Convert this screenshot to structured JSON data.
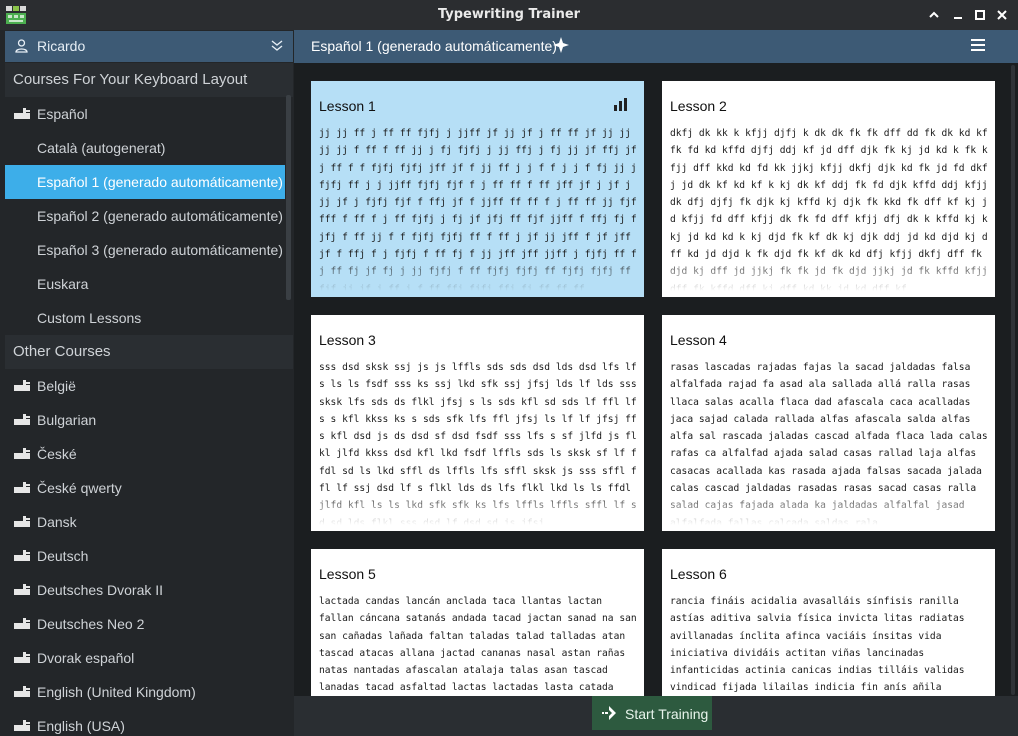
{
  "window": {
    "title": "Typewriting Trainer"
  },
  "sidebar": {
    "profile": "Ricardo",
    "section_courses": "Courses For Your Keyboard Layout",
    "courses": [
      {
        "label": "Español",
        "icon": "keyboard-icon"
      },
      {
        "label": "Català (autogenerat)"
      },
      {
        "label": "Español 1 (generado automáticamente)",
        "selected": true
      },
      {
        "label": "Español 2 (generado automáticamente)"
      },
      {
        "label": "Español 3 (generado automáticamente)"
      },
      {
        "label": "Euskara"
      },
      {
        "label": "Custom Lessons"
      }
    ],
    "section_other": "Other Courses",
    "other": [
      {
        "label": "België"
      },
      {
        "label": "Bulgarian"
      },
      {
        "label": "České"
      },
      {
        "label": "České qwerty"
      },
      {
        "label": "Dansk"
      },
      {
        "label": "Deutsch"
      },
      {
        "label": "Deutsches Dvorak II"
      },
      {
        "label": "Deutsches Neo 2"
      },
      {
        "label": "Dvorak español"
      },
      {
        "label": "English (United Kingdom)"
      },
      {
        "label": "English (USA)"
      }
    ]
  },
  "header": {
    "course_title": "Español 1 (generado automáticamente)"
  },
  "lessons": [
    {
      "title": "Lesson 1",
      "text": "jj jj ff j ff ff fjfj j jjff jf jj jf j ff ff jf jj jj jj jj f ff f ff jj j fj fjfj j jj ffj j fj jj jf ffj jf j ff f f fjfj fjfj jff jf f jj ff j j f f j j f fj jj j fjfj ff j j jjff fjfj fjf f j ff ff f ff jff jf j jf j jj jf j fjfj fjf f ffj jf f jjff ff ff f j ff ff jj fjf fff f ff f j ff fjfj j fj jf jfj ff fjf jjff f ffj fj fjfj f ff jj f f fjfj fjfj ff f ff j jf jj jff f jf jff jf f ffj f j fjfj f ff fj f jj jff jff jjff j fjfj ff fj ff fj jf fj j jj fjfj f ff fjfj fjfj ff fjfj fjfj ff fjf jj jf j ff j f ff ffj fjfj ffj fj ff ff ff"
    },
    {
      "title": "Lesson 2",
      "text": "dkfj dk kk k kfjj djfj k dk dk fk fk dff dd fk dk kd kf fk fd kd kffd djfj ddj kf jd dff djk fk kj jd kd k fk kfjj dff kkd kd fd kk jjkj kfjj dkfj djk kd fk jd fd dkfj jd dk kf kd kf k kj dk kf ddj fk fd djk kffd ddj kfjj dk dfj djfj fk djk kj kffd kj djk fk kkd fk dff kf kj jd kfjj fd dff kfjj dk fk fd dff kfjj dfj dk k kffd kj k kj jd kd kd k kj djd fk kf dk kj djk ddj jd kd djd kj dff kd jd djd k fk djd fk kf dk kd dfj kfjj dkfj dff fk djd kj dff jd jjkj fk fk jd fk djd jjkj jd fk kffd kfjj dff fk kffd dff kj dff kd kk jd kd dff kf"
    },
    {
      "title": "Lesson 3",
      "text": "sss dsd sksk ssj js js lffls sds sds dsd lds dsd lfs lfs ls ls fsdf sss ks ssj lkd sfk ssj jfsj lds lf lds sss sksk lfs sds ds flkl jfsj s ls sds kfl sd sds lf ffl lfs s kfl kkss ks s sds sfk lfs ffl jfsj ls lf lf jfsj ffs kfl dsd js ds dsd sf dsd fsdf sss lfs s sf jlfd js flkl jlfd kkss dsd kfl lkd fsdf lffls sds ls sksk sf lf ffdl sd ls lkd sffl ds lffls lfs sffl sksk js sss sffl ffl lf ssj dsd lf s flkl lds ds lfs flkl lkd ls ls ffdl jlfd kfl ls ls lkd sfk sfk ks lfs lffls lffls sffl lf sd sd lds flkl sss dsd lf dsd sd js jfsj"
    },
    {
      "title": "Lesson 4",
      "text": "rasas lascadas rajadas fajas la sacad jaldadas falsa alfalfada rajad fa asad ala sallada allá ralla rasas llaca salas acalla flaca dad afascala caca acalladas jaca sajad calada rallada alfas afascala salda alfas alfa sal rascada jaladas cascad alfada flaca lada calas rafas ca alfalfad ajada salad casas rallad laja alfas casacas acallada kas rasada ajada falsas sacada jalada calas cascad jaldadas rasadas rasas sacad casas ralla salad cajas fajada alada ka jaldadas alfalfal jasad alfalfada fallas calcada saldas rala"
    },
    {
      "title": "Lesson 5",
      "text": "lactada candas lancán anclada taca llantas lactan fallan cáncana satanás andada tacad jactan sanad na san san cañadas lañada faltan taladas talad talladas atan tascad atacas allana jactad cananas nasal astan rañas natas nantadas afascalan atalaja talas asan tascad lanadas tacad asfaltad lactas lactadas lasta catada catalán talladas cañadas andana"
    },
    {
      "title": "Lesson 6",
      "text": "rancia fináis acidalia avasalláis sínfisis ranilla astías aditiva salvia física invicta litas radiatas avillanadas ínclita afinca vaciáis ínsitas vida iniciativa dividáis actitan viñas lancinadas infanticidas actinia canicas indias tilláis validas vindicad fijada lilailas indicia fin anís añila vivificas fantasías indician calificativa nía lijáis"
    }
  ],
  "footer": {
    "start_label": "Start Training"
  }
}
